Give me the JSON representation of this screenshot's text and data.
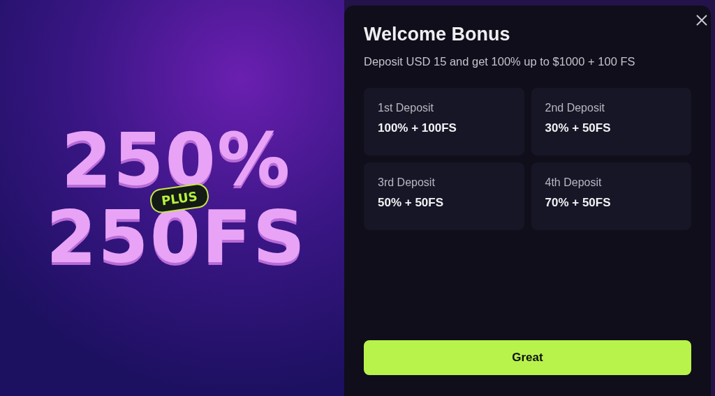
{
  "banner": {
    "headline": "250%",
    "badge": "PLUS",
    "subline": "250FS"
  },
  "dialog": {
    "title": "Welcome Bonus",
    "subtitle": "Deposit USD 15 and get 100% up to $1000 + 100 FS",
    "deposits": [
      {
        "label": "1st Deposit",
        "value": "100% + 100FS"
      },
      {
        "label": "2nd Deposit",
        "value": "30% + 50FS"
      },
      {
        "label": "3rd Deposit",
        "value": "50% + 50FS"
      },
      {
        "label": "4th Deposit",
        "value": "70% + 50FS"
      }
    ],
    "button": "Great"
  }
}
